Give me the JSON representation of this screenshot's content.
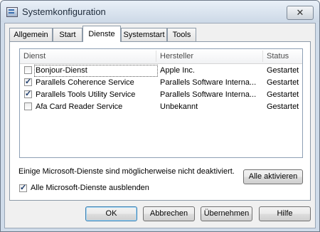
{
  "window": {
    "title": "Systemkonfiguration",
    "close_glyph": "✕"
  },
  "tabs": [
    {
      "label": "Allgemein"
    },
    {
      "label": "Start"
    },
    {
      "label": "Dienste"
    },
    {
      "label": "Systemstart"
    },
    {
      "label": "Tools"
    }
  ],
  "active_tab": "Dienste",
  "list": {
    "columns": [
      "Dienst",
      "Hersteller",
      "Status"
    ],
    "rows": [
      {
        "checked": false,
        "service": "Bonjour-Dienst",
        "vendor": "Apple Inc.",
        "status": "Gestartet",
        "check_glyph": ""
      },
      {
        "checked": true,
        "service": "Parallels Coherence Service",
        "vendor": "Parallels Software Interna...",
        "status": "Gestartet",
        "check_glyph": "✓"
      },
      {
        "checked": true,
        "service": "Parallels Tools Utility Service",
        "vendor": "Parallels Software Interna...",
        "status": "Gestartet",
        "check_glyph": "✓"
      },
      {
        "checked": false,
        "service": "Afa Card Reader Service",
        "vendor": "Unbekannt",
        "status": "Gestartet",
        "check_glyph": ""
      }
    ]
  },
  "note": "Einige Microsoft-Dienste sind möglicherweise nicht deaktiviert.",
  "enable_all_label": "Alle aktivieren",
  "hide_ms": {
    "checked": true,
    "label": "Alle Microsoft-Dienste ausblenden",
    "check_glyph": "✓"
  },
  "buttons": {
    "ok": "OK",
    "cancel": "Abbrechen",
    "apply": "Übernehmen",
    "help": "Hilfe"
  },
  "colors": {
    "title_bar": "#cdd9e7",
    "default_button_border": "#3c7fb1"
  }
}
